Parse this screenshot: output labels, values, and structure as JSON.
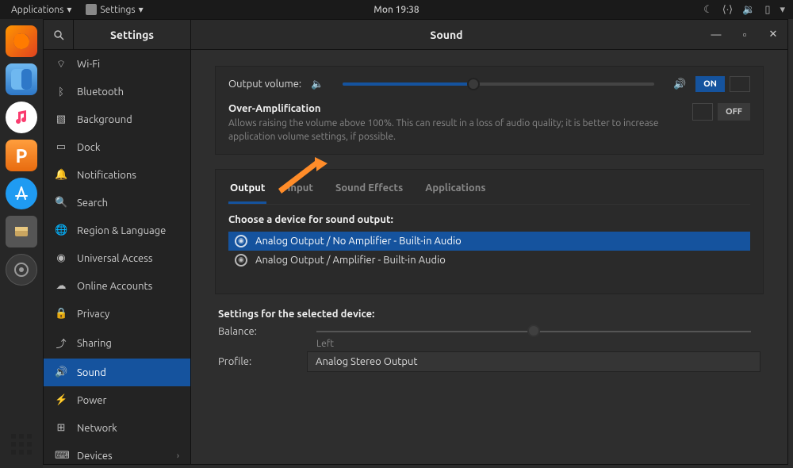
{
  "topbar": {
    "applications": "Applications",
    "settings_menu": "Settings",
    "clock": "Mon 19:38"
  },
  "window": {
    "app_title": "Settings",
    "panel_title": "Sound"
  },
  "sidebar": {
    "items": [
      {
        "icon": "wifi",
        "label": "Wi-Fi"
      },
      {
        "icon": "bt",
        "label": "Bluetooth"
      },
      {
        "icon": "bg",
        "label": "Background"
      },
      {
        "icon": "dock",
        "label": "Dock"
      },
      {
        "icon": "notif",
        "label": "Notifications"
      },
      {
        "icon": "search",
        "label": "Search"
      },
      {
        "icon": "region",
        "label": "Region & Language"
      },
      {
        "icon": "access",
        "label": "Universal Access"
      },
      {
        "icon": "online",
        "label": "Online Accounts"
      },
      {
        "icon": "privacy",
        "label": "Privacy"
      },
      {
        "icon": "sharing",
        "label": "Sharing"
      },
      {
        "icon": "sound",
        "label": "Sound"
      },
      {
        "icon": "power",
        "label": "Power"
      },
      {
        "icon": "network",
        "label": "Network"
      },
      {
        "icon": "devices",
        "label": "Devices"
      }
    ]
  },
  "sound": {
    "output_volume_label": "Output volume:",
    "output_volume_percent": 42,
    "toggle_on": "ON",
    "overamp": {
      "title": "Over-Amplification",
      "desc": "Allows raising the volume above 100%. This can result in a loss of audio quality; it is better to increase application volume settings, if possible.",
      "toggle": "OFF"
    },
    "tabs": [
      "Output",
      "Input",
      "Sound Effects",
      "Applications"
    ],
    "choose_device": "Choose a device for sound output:",
    "devices": [
      "Analog Output / No Amplifier - Built-in Audio",
      "Analog Output / Amplifier - Built-in Audio"
    ],
    "settings_for_device": "Settings for the selected device:",
    "balance_label": "Balance:",
    "balance_left": "Left",
    "profile_label": "Profile:",
    "profile_value": "Analog Stereo Output"
  }
}
